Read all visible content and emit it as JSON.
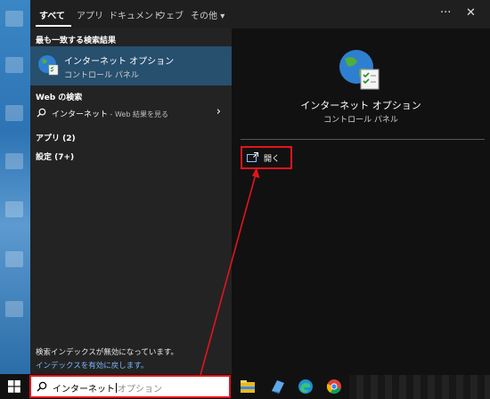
{
  "tabs": [
    "すべて",
    "アプリ",
    "ドキュメント",
    "ウェブ",
    "その他"
  ],
  "topbar": {
    "more_label": "···",
    "close_label": "✕",
    "more_dropdown": "▾"
  },
  "left": {
    "best_match_heading": "最も一致する検索結果",
    "best_match_title": "インターネット オプション",
    "best_match_subtitle": "コントロール パネル",
    "web_heading": "Web の検索",
    "web_query": "インターネット",
    "web_suffix": " - Web 結果を見る",
    "apps_heading": "アプリ (2)",
    "settings_heading": "設定 (7+)",
    "footer_note": "検索インデックスが無効になっています。",
    "footer_link": "インデックスを有効に戻します。"
  },
  "right": {
    "title": "インターネット オプション",
    "subtitle": "コントロール パネル",
    "open_label": "開く"
  },
  "search": {
    "typed": "インターネット",
    "suggestion": "オプション"
  },
  "colors": {
    "annotation": "#e3141b",
    "link": "#7cb7ff",
    "selected": "#274f6e"
  },
  "icons": [
    "globe-icon",
    "search-icon",
    "open-icon",
    "windows-icon",
    "chevron-right-icon",
    "file-explorer-icon",
    "edge-icon",
    "chrome-icon"
  ]
}
